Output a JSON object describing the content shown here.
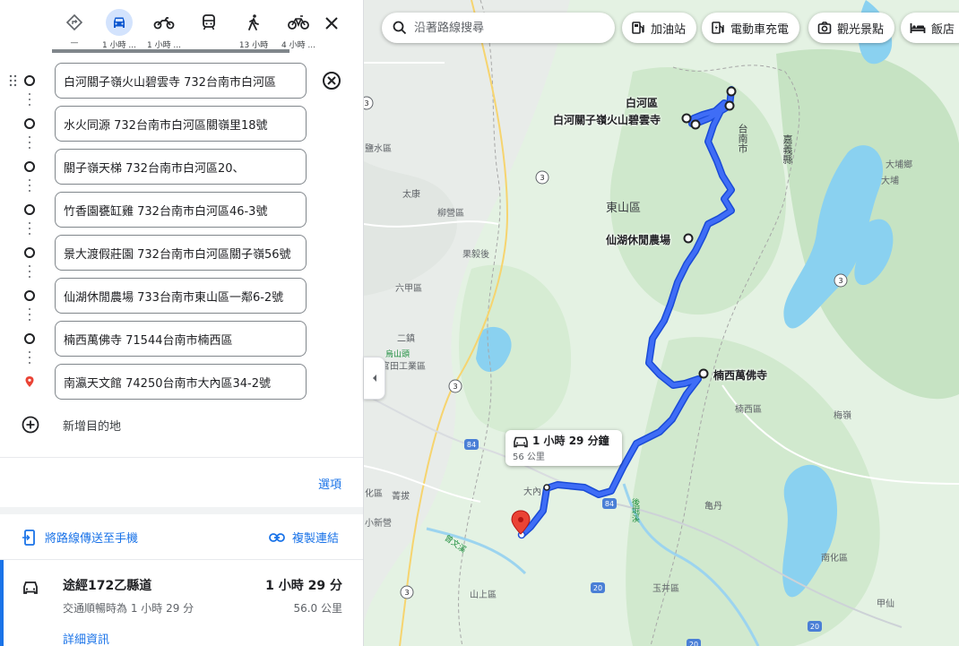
{
  "travel_modes": [
    {
      "name": "best",
      "label": "—"
    },
    {
      "name": "driving",
      "label": "1 小時 ..."
    },
    {
      "name": "motorcycle",
      "label": "1 小時 ..."
    },
    {
      "name": "transit",
      "label": ""
    },
    {
      "name": "walking",
      "label": "13 小時"
    },
    {
      "name": "cycling",
      "label": "4 小時 ..."
    }
  ],
  "stops": [
    {
      "value": "白河關子嶺火山碧雲寺 732台南市白河區"
    },
    {
      "value": "水火同源 732台南市白河區關嶺里18號"
    },
    {
      "value": "關子嶺天梯 732台南市白河區20、"
    },
    {
      "value": "竹香園甕缸雞 732台南市白河區46-3號"
    },
    {
      "value": "景大渡假莊園 732台南市白河區關子嶺56號"
    },
    {
      "value": "仙湖休閒農場 733台南市東山區一鄰6-2號"
    },
    {
      "value": "楠西萬佛寺 71544台南市楠西區"
    },
    {
      "value": "南瀛天文館 74250台南市大內區34-2號"
    }
  ],
  "add_destination": "新增目的地",
  "options": "選項",
  "send_to_phone": "將路線傳送至手機",
  "copy_link": "複製連結",
  "route": {
    "via": "途經172乙縣道",
    "time": "1 小時 29 分",
    "traffic": "交通順暢時為 1 小時 29 分",
    "distance": "56.0 公里",
    "details": "詳細資訊"
  },
  "map": {
    "search_placeholder": "沿著路線搜尋",
    "chips": [
      "加油站",
      "電動車充電",
      "觀光景點",
      "飯店"
    ],
    "route_box": {
      "time": "1 小時 29 分鐘",
      "distance": "56 公里"
    },
    "poi_labels": [
      "白河區",
      "白河關子嶺火山碧雲寺",
      "仙湖休閒農場",
      "楠西萬佛寺",
      "東山區"
    ],
    "place_labels": [
      "鹽水區",
      "太康",
      "柳營區",
      "果毅後",
      "六甲區",
      "二鎮",
      "烏山頭",
      "官田工業區",
      "楠西區",
      "大內",
      "南化區",
      "玉井區",
      "山上區",
      "化區",
      "菁拔",
      "小新營",
      "梅嶺",
      "大埔鄉",
      "大埔",
      "亀丹",
      "甲仙"
    ],
    "road_shields": [
      "3",
      "3",
      "84",
      "84",
      "3",
      "3",
      "3",
      "20",
      "20",
      "20"
    ],
    "vertical_labels": [
      "台南市",
      "嘉義縣"
    ],
    "river_labels": [
      "曾文溪",
      "後堀溪"
    ]
  }
}
